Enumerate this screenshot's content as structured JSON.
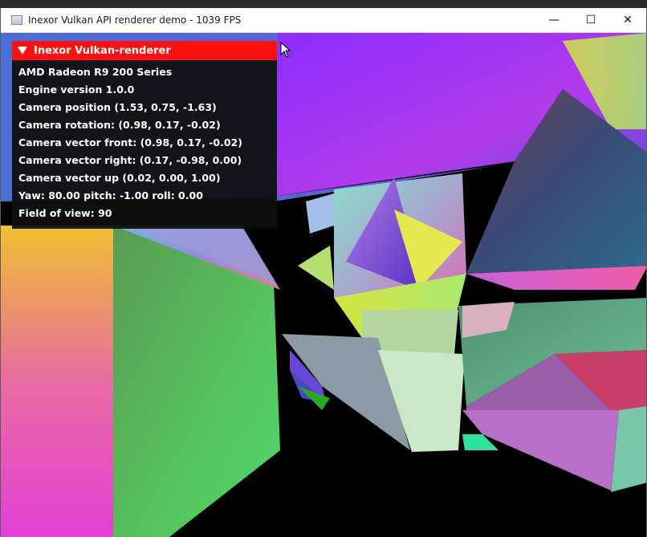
{
  "window": {
    "title": "Inexor Vulkan API renderer demo - 1039 FPS",
    "buttons": {
      "minimize": "—",
      "maximize": "☐",
      "close": "✕"
    }
  },
  "overlay": {
    "header": "Inexor Vulkan-renderer",
    "lines": [
      "AMD Radeon R9 200 Series",
      "Engine version 1.0.0",
      "Camera position (1.53, 0.75, -1.63)",
      "Camera rotation: (0.98, 0.17, -0.02)",
      "Camera vector front: (0.98, 0.17, -0.02)",
      "Camera vector right: (0.17, -0.98, 0.00)",
      "Camera vector up (0.02, 0.00, 1.00)",
      "Yaw: 80.00 pitch: -1.00 roll: 0.00",
      "Field of view: 90"
    ]
  },
  "colors": {
    "header_red": "#ff1010",
    "panel_bg": "#0f0f0f"
  }
}
